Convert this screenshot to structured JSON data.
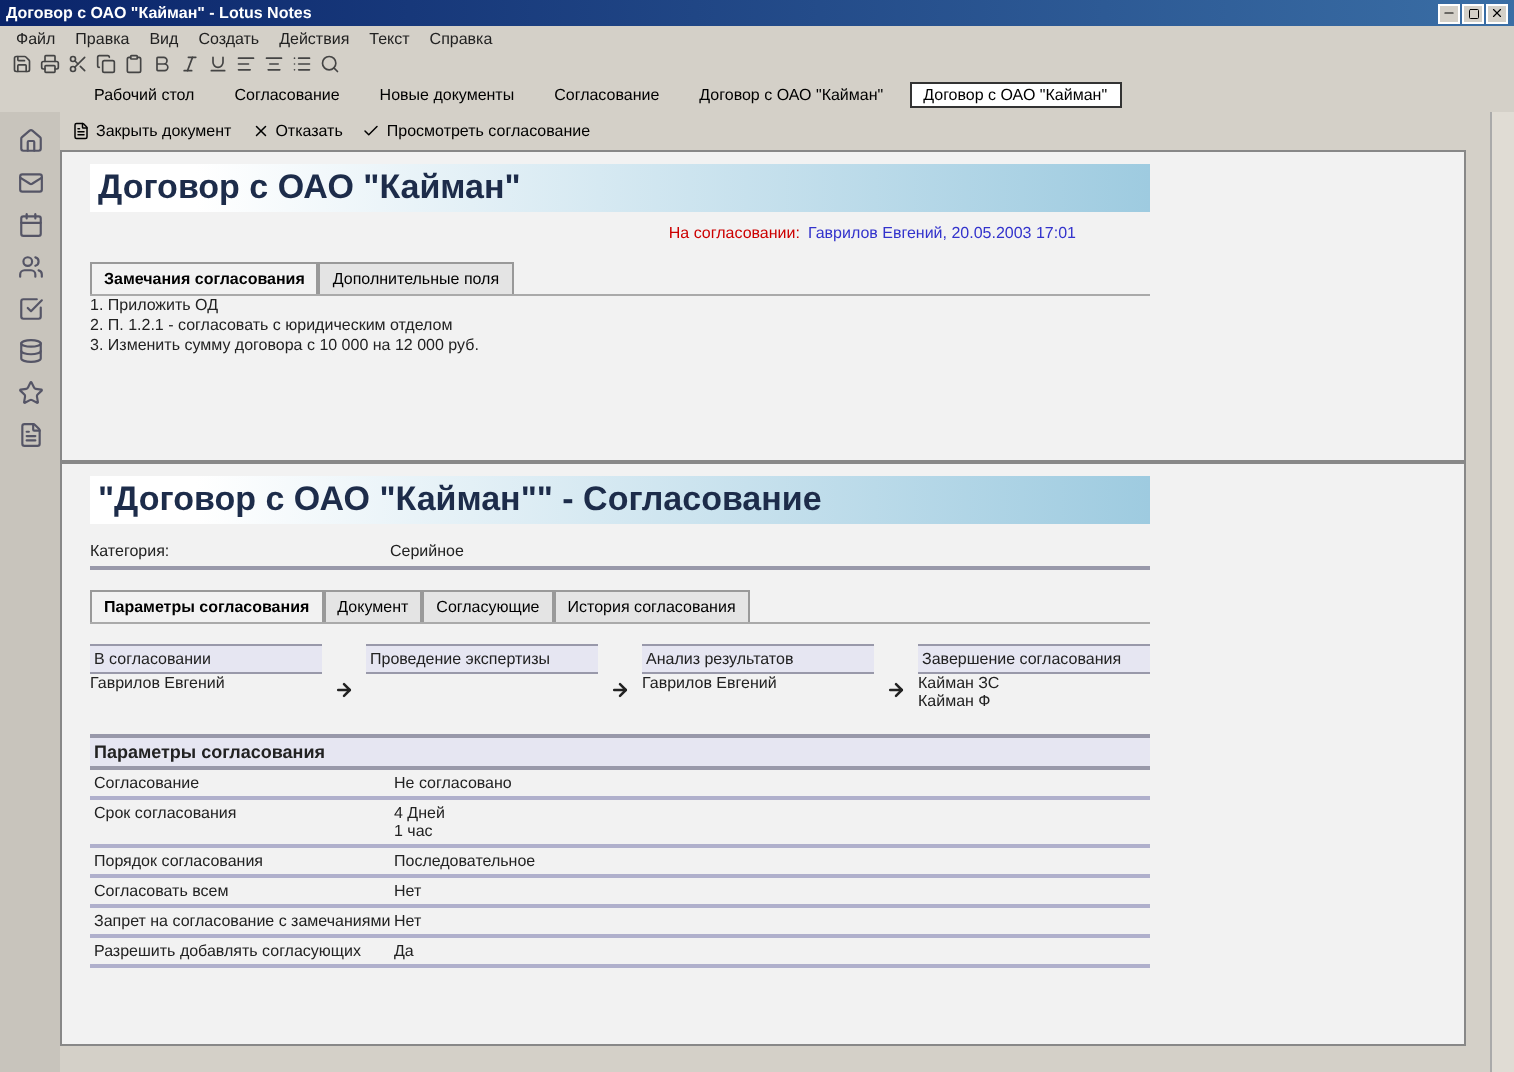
{
  "window": {
    "title": "Договор с ОАО \"Кайман\" - Lotus Notes"
  },
  "menu": [
    "Файл",
    "Правка",
    "Вид",
    "Создать",
    "Действия",
    "Текст",
    "Справка"
  ],
  "bookmarks": [
    {
      "label": "Рабочий стол",
      "selected": false
    },
    {
      "label": "Согласование",
      "selected": false
    },
    {
      "label": "Новые документы",
      "selected": false
    },
    {
      "label": "Согласование",
      "selected": false
    },
    {
      "label": "Договор с ОАО \"Кайман\"",
      "selected": false
    },
    {
      "label": "Договор с ОАО \"Кайман\"",
      "selected": true
    }
  ],
  "actions": [
    "Закрыть документ",
    "Отказать",
    "Просмотреть согласование"
  ],
  "top_doc": {
    "title": "Договор с ОАО \"Кайман\"",
    "status_label": "На согласовании:",
    "status_value": "Гаврилов Евгений, 20.05.2003 17:01",
    "tabs": [
      {
        "label": "Замечания согласования",
        "selected": true
      },
      {
        "label": "Дополнительные поля",
        "selected": false
      }
    ],
    "lines": [
      "1. Приложить ОД",
      "2. П. 1.2.1 - согласовать с юридическим отделом",
      "3. Изменить сумму договора с 10 000 на 12 000 руб."
    ]
  },
  "bottom_doc": {
    "title": "\"Договор с ОАО \"Кайман\"\" - Согласование",
    "category_label": "Категория:",
    "category_value": "Серийное",
    "tabs": [
      {
        "label": "Параметры согласования",
        "selected": true
      },
      {
        "label": "Документ",
        "selected": false
      },
      {
        "label": "Согласующие",
        "selected": false
      },
      {
        "label": "История согласования",
        "selected": false
      }
    ],
    "stages": [
      {
        "heading": "В согласовании",
        "names": [
          "Гаврилов Евгений"
        ]
      },
      {
        "heading": "Проведение экспертизы"
      },
      {
        "heading": "Анализ результатов",
        "names": [
          "Гаврилов Евгений"
        ]
      },
      {
        "heading": "Завершение согласования",
        "names": [
          "Кайман ЗС",
          "Кайман Ф"
        ]
      }
    ],
    "params_heading": "Параметры согласования",
    "params": [
      {
        "label": "Согласование",
        "values": [
          "Не согласовано"
        ]
      },
      {
        "label": "Срок согласования",
        "values": [
          "4 Дней",
          "1 час"
        ]
      },
      {
        "label": "Порядок согласования",
        "values": [
          "Последовательное"
        ]
      },
      {
        "label": "Согласовать всем",
        "values": [
          "Нет"
        ]
      },
      {
        "label": "Запрет на согласование с замечаниями",
        "values": [
          "Нет"
        ]
      },
      {
        "label": "Разрешить добавлять согласующих",
        "values": [
          "Да"
        ]
      }
    ]
  }
}
